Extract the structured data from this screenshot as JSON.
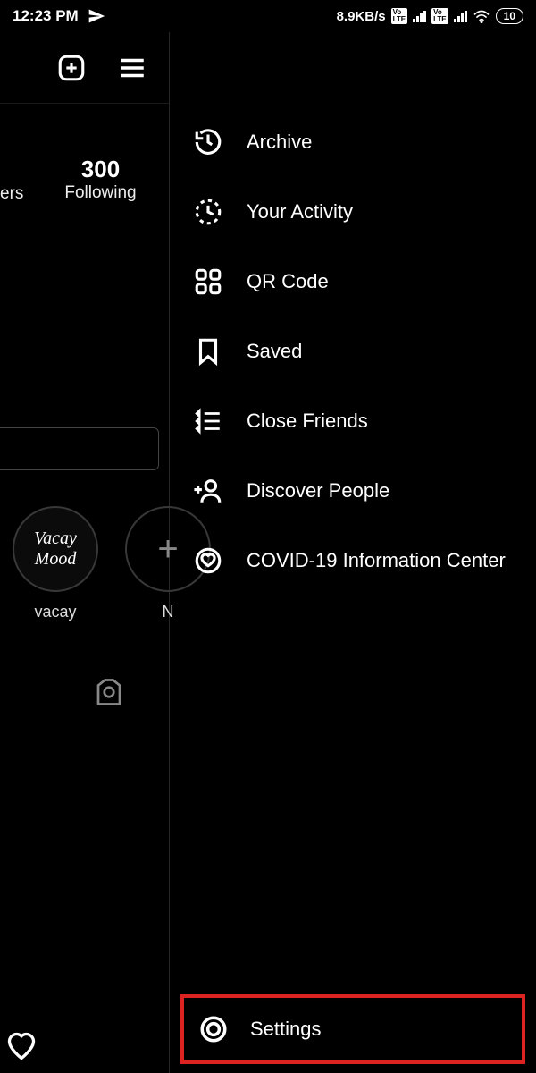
{
  "status": {
    "time": "12:23 PM",
    "net_speed": "8.9KB/s",
    "battery": "10"
  },
  "profile": {
    "following_count": "300",
    "following_label": "Following",
    "followers_suffix": "ers",
    "highlight1_label": "vacay",
    "highlight1_text": "Vacay Mood",
    "highlight_new_label": "N"
  },
  "menu": {
    "archive": "Archive",
    "activity": "Your Activity",
    "qr": "QR Code",
    "saved": "Saved",
    "close_friends": "Close Friends",
    "discover": "Discover People",
    "covid": "COVID-19 Information Center",
    "settings": "Settings"
  }
}
